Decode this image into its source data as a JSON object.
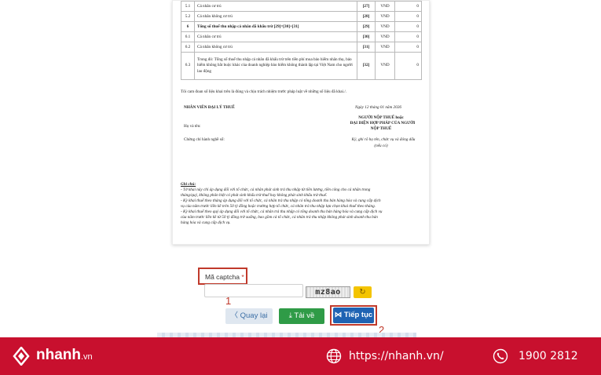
{
  "table": {
    "rows": [
      {
        "no": "5.1",
        "desc": "Cá nhân cư trú",
        "code": "[27]",
        "unit": "VND",
        "value": "0",
        "bold": false,
        "tall": false
      },
      {
        "no": "5.2",
        "desc": "Cá nhân không cư trú",
        "code": "[28]",
        "unit": "VND",
        "value": "0",
        "bold": false,
        "tall": false
      },
      {
        "no": "6",
        "desc": "Tổng số thuế thu nhập cá nhân đã khấu trừ [29]=[30]+[31]",
        "code": "[29]",
        "unit": "VND",
        "value": "0",
        "bold": true,
        "tall": false
      },
      {
        "no": "6.1",
        "desc": "Cá nhân cư trú",
        "code": "[30]",
        "unit": "VND",
        "value": "0",
        "bold": false,
        "tall": false
      },
      {
        "no": "6.2",
        "desc": "Cá nhân không cư trú",
        "code": "[31]",
        "unit": "VND",
        "value": "0",
        "bold": false,
        "tall": false
      },
      {
        "no": "6.3",
        "desc": "Trong đó: Tổng số thuế thu nhập cá nhân đã khấu trừ trên tiền phí mua bảo hiểm nhân thọ, bảo hiểm không bắt buộc khác của doanh nghiệp bảo hiểm không thành lập tại Việt Nam cho người lao động",
        "code": "[32]",
        "unit": "VND",
        "value": "0",
        "bold": false,
        "tall": true
      }
    ]
  },
  "document": {
    "commitment": "Tôi cam đoan số liệu khai trên là đúng và chịu trách nhiệm trước pháp luật về những số liệu đã khai./.",
    "agent_heading": "NHÂN VIÊN ĐẠI LÝ THUẾ",
    "date_line": "Ngày 12 tháng 01 năm 2026",
    "taxpayer_heading_1": "NGƯỜI NỘP THUẾ hoặc",
    "taxpayer_heading_2": "ĐẠI DIỆN HỢP PHÁP CỦA NGƯỜI",
    "taxpayer_heading_3": "NỘP THUẾ",
    "name_label": "Họ và tên:",
    "cert_label": "Chứng chỉ hành nghề số:",
    "sign_note_1": "Ký, ghi rõ họ tên, chức vụ và đóng dấu",
    "sign_note_2": "(nếu có)",
    "notes_title": "Ghi chú:",
    "notes": [
      "- Tờ khai này chỉ áp dụng đối với tổ chức, cá nhân phát sinh trả thu nhập từ tiền lương, tiền công cho cá nhân trong",
      "tháng/quý, không phân biệt có phát sinh khấu trừ thuế hay không phát sinh khấu trừ thuế.",
      "- Kỳ khai thuế theo tháng áp dụng đối với tổ chức, cá nhân trả thu nhập có tổng doanh thu bán hàng hóa và cung cấp dịch",
      "vụ của năm trước liền kề trên 50 tỷ đồng hoặc trường hợp tổ chức, cá nhân trả thu nhập lựa chọn khai thuế theo tháng.",
      "- Kỳ khai thuế theo quý áp dụng đối với tổ chức, cá nhân trả thu nhập có tổng doanh thu bán hàng hóa và cung cấp dịch vụ",
      "của năm trước liền kề từ 50 tỷ đồng trở xuống, bao gồm cả tổ chức, cá nhân trả thu nhập không phát sinh doanh thu bán",
      "hàng hóa và cung cấp dịch vụ."
    ]
  },
  "captcha": {
    "label": "Mã captcha",
    "required_mark": "*",
    "input_value": "",
    "code": "mz8ao",
    "refresh_glyph": "↻"
  },
  "annotations": {
    "step1": "1",
    "step2": "2"
  },
  "buttons": {
    "back": "〈  Quay lại",
    "download": "⤓  Tải về",
    "continue": "⋈  Tiếp tục"
  },
  "footer": {
    "brand": "nhanh",
    "brand_suffix": ".vn",
    "website": "https://nhanh.vn/",
    "hotline": "1900 2812"
  },
  "colors": {
    "footer_bg": "#c8102e",
    "highlight": "#c0392b",
    "continue_btn": "#1f63b3",
    "download_btn": "#2f9b47",
    "refresh_btn": "#f4c400"
  }
}
